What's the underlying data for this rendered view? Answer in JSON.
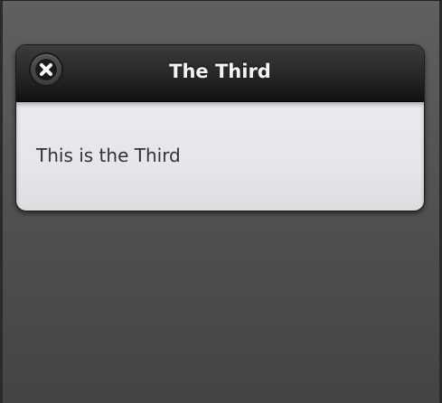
{
  "dialog": {
    "title": "The Third",
    "content": "This is the Third",
    "close_icon": "close-x-icon"
  }
}
